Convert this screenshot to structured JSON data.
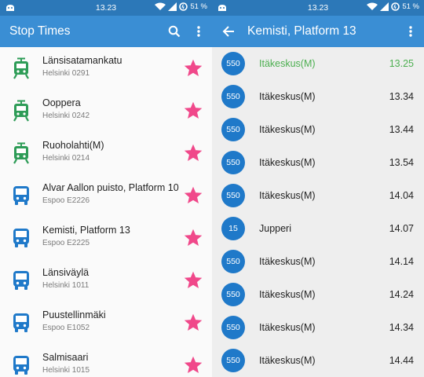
{
  "colors": {
    "statusbar": "#2c78b8",
    "appbar": "#3a8ed4",
    "tram": "#2e9c57",
    "bus": "#1f79c9",
    "star": "#f0488a",
    "current_departure": "#4caf50"
  },
  "left_screen": {
    "statusbar": {
      "time": "13.23",
      "battery": "51 %"
    },
    "appbar": {
      "title": "Stop Times",
      "actions": [
        "search-icon",
        "more-vert-icon"
      ]
    },
    "stops": [
      {
        "name": "Länsisatamankatu",
        "code": "Helsinki 0291",
        "type": "tram",
        "favorite": true
      },
      {
        "name": "Ooppera",
        "code": "Helsinki 0242",
        "type": "tram",
        "favorite": true
      },
      {
        "name": "Ruoholahti(M)",
        "code": "Helsinki 0214",
        "type": "tram",
        "favorite": true
      },
      {
        "name": "Alvar Aallon puisto, Platform 10",
        "code": "Espoo E2226",
        "type": "bus",
        "favorite": true
      },
      {
        "name": "Kemisti, Platform 13",
        "code": "Espoo E2225",
        "type": "bus",
        "favorite": true
      },
      {
        "name": "Länsiväylä",
        "code": "Helsinki 1011",
        "type": "bus",
        "favorite": true
      },
      {
        "name": "Puustellinmäki",
        "code": "Espoo E1052",
        "type": "bus",
        "favorite": true
      },
      {
        "name": "Salmisaari",
        "code": "Helsinki 1015",
        "type": "bus",
        "favorite": true
      }
    ]
  },
  "right_screen": {
    "statusbar": {
      "time": "13.23",
      "battery": "51 %"
    },
    "appbar": {
      "title": "Kemisti, Platform 13",
      "actions": [
        "back-arrow-icon",
        "more-vert-icon"
      ]
    },
    "departures": [
      {
        "route": "550",
        "destination": "Itäkeskus(M)",
        "time": "13.25",
        "current": true
      },
      {
        "route": "550",
        "destination": "Itäkeskus(M)",
        "time": "13.34",
        "current": false
      },
      {
        "route": "550",
        "destination": "Itäkeskus(M)",
        "time": "13.44",
        "current": false
      },
      {
        "route": "550",
        "destination": "Itäkeskus(M)",
        "time": "13.54",
        "current": false
      },
      {
        "route": "550",
        "destination": "Itäkeskus(M)",
        "time": "14.04",
        "current": false
      },
      {
        "route": "15",
        "destination": "Jupperi",
        "time": "14.07",
        "current": false
      },
      {
        "route": "550",
        "destination": "Itäkeskus(M)",
        "time": "14.14",
        "current": false
      },
      {
        "route": "550",
        "destination": "Itäkeskus(M)",
        "time": "14.24",
        "current": false
      },
      {
        "route": "550",
        "destination": "Itäkeskus(M)",
        "time": "14.34",
        "current": false
      },
      {
        "route": "550",
        "destination": "Itäkeskus(M)",
        "time": "14.44",
        "current": false
      }
    ]
  }
}
